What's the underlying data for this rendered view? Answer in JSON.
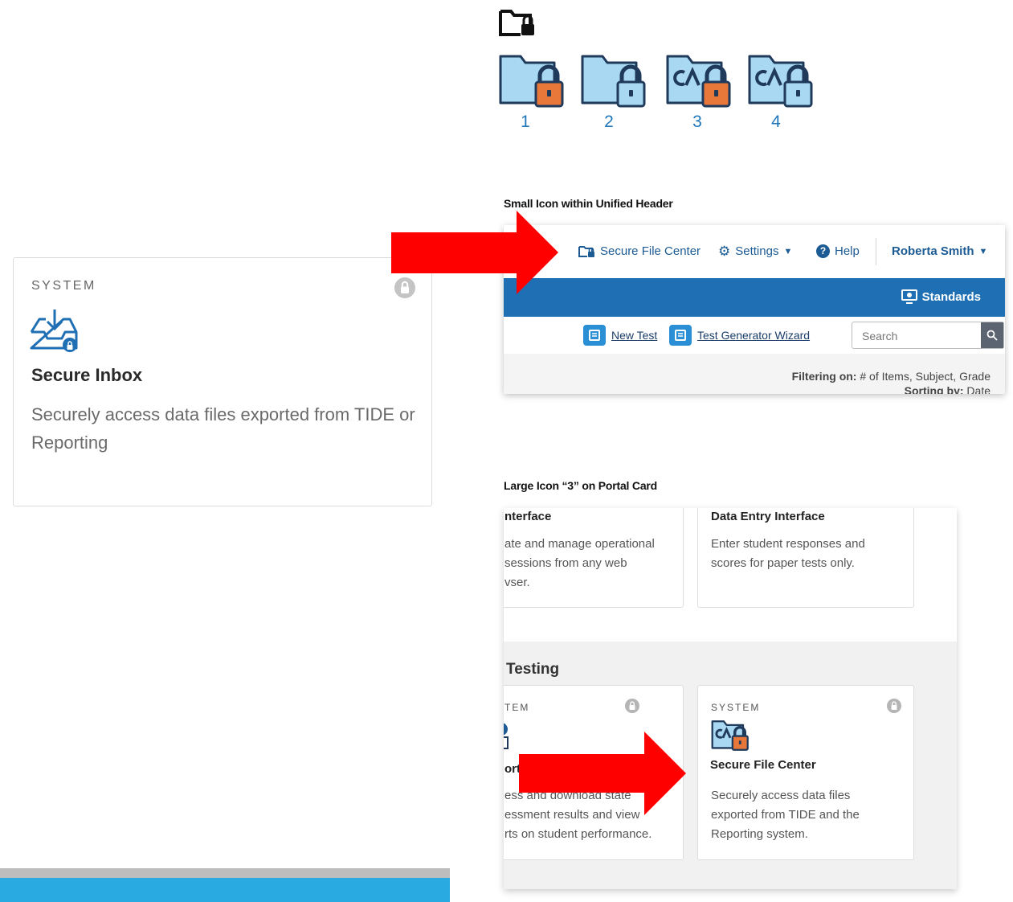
{
  "inbox_card": {
    "kicker": "SYSTEM",
    "title": "Secure Inbox",
    "description": "Securely access data files exported from TIDE or Reporting"
  },
  "icon_variants": {
    "labels": [
      "1",
      "2",
      "3",
      "4"
    ]
  },
  "section_labels": {
    "small_icon": "Small Icon within Unified Header",
    "large_icon": "Large Icon “3” on Portal Card"
  },
  "unified_header": {
    "secure_file_center": "Secure File Center",
    "settings": "Settings",
    "help": "Help",
    "user_name": "Roberta Smith",
    "standards": "Standards",
    "new_test": "New Test",
    "test_generator_wizard": "Test Generator Wizard",
    "search_placeholder": "Search",
    "filtering_label": "Filtering on:",
    "filtering_value": " # of Items, Subject, Grade",
    "sorting_label": "Sorting by:",
    "sorting_value": " Date"
  },
  "portal": {
    "card_a_title": "nterface",
    "card_a_desc": [
      "ate and manage operational",
      " sessions from any web",
      "vser."
    ],
    "card_b_title": "Data Entry Interface",
    "card_b_desc": [
      "Enter student responses and",
      "scores for paper tests only."
    ],
    "section_heading": "Testing",
    "card_c_kicker": "TEM",
    "card_c_title": "ort",
    "card_c_desc": [
      "ess and download state",
      "essment results and view",
      "rts on student performance."
    ],
    "card_d_kicker": "SYSTEM",
    "card_d_title": "Secure File Center",
    "card_d_desc": [
      "Securely access data files",
      "exported from TIDE and the",
      "Reporting system."
    ]
  },
  "colors": {
    "folder_fill": "#a9d8f2",
    "folder_stroke": "#1f3a5a",
    "lock_orange": "#e8773a",
    "lock_blue": "#3a8fd0",
    "arrow_red": "#ff0000",
    "header_band": "#1f6fb5",
    "accent_bar": "#29abe2"
  },
  "icons": [
    "folder-lock-outline-icon",
    "folder-lock-icon",
    "folder-ca-lock-icon",
    "inbox-download-icon",
    "lock-circle-icon",
    "gear-icon",
    "help-circle-icon",
    "chevron-down-icon",
    "monitor-icon",
    "search-icon",
    "red-arrow"
  ]
}
